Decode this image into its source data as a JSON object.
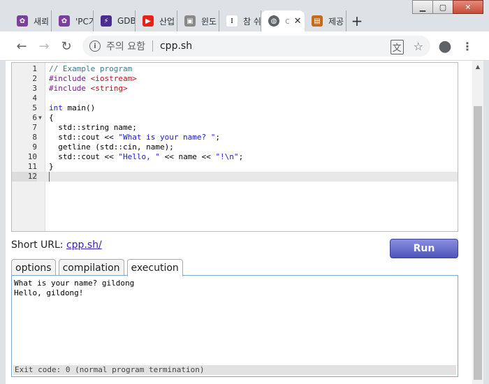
{
  "window": {
    "minimize": "▁",
    "maximize": "▢",
    "close": "✕"
  },
  "tabs": [
    {
      "label": "새뢰",
      "icon_color": "#7b3fa0",
      "icon": "flower-icon"
    },
    {
      "label": "'PC가",
      "icon_color": "#7b3fa0",
      "icon": "flower-icon"
    },
    {
      "label": "GDB",
      "icon_color": "#4a2d8c",
      "icon": "bolt-icon"
    },
    {
      "label": "산업",
      "icon_color": "#e62117",
      "icon": "youtube-icon"
    },
    {
      "label": "윈도",
      "icon_color": "#888888",
      "icon": "computer-icon"
    },
    {
      "label": "참 쉬",
      "icon_color": "#333333",
      "icon": "tistory-icon"
    },
    {
      "label": "c",
      "icon_color": "#5f6368",
      "icon": "globe-icon",
      "active": true
    },
    {
      "label": "제공",
      "icon_color": "#c46a1a",
      "icon": "book-icon"
    }
  ],
  "toolbar": {
    "warning": "주의 요함",
    "url": "cpp.sh"
  },
  "editor": {
    "lines": [
      "// Example program",
      "#include <iostream>",
      "#include <string>",
      "",
      "int main()",
      "{",
      "  std::string name;",
      "  std::cout << \"What is your name? \";",
      "  getline (std::cin, name);",
      "  std::cout << \"Hello, \" << name << \"!\\n\";",
      "}",
      ""
    ]
  },
  "short_url": {
    "label": "Short URL:",
    "link": "cpp.sh/"
  },
  "run_label": "Run",
  "panel_tabs": [
    {
      "label": "options"
    },
    {
      "label": "compilation"
    },
    {
      "label": "execution",
      "active": true
    }
  ],
  "output": {
    "text": "What is your name? gildong\nHello, gildong!",
    "exit": "Exit code: 0 (normal program termination)"
  }
}
